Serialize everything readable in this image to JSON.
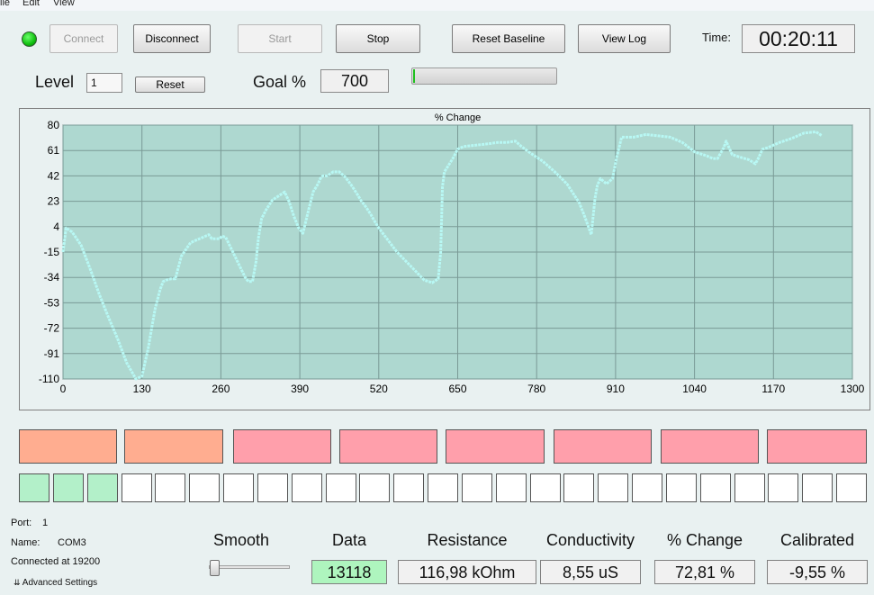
{
  "menu": {
    "file": "ile",
    "edit": "Edit",
    "view": "View"
  },
  "toolbar": {
    "connect": "Connect",
    "disconnect": "Disconnect",
    "start": "Start",
    "stop": "Stop",
    "reset_baseline": "Reset Baseline",
    "view_log": "View Log",
    "time_label": "Time:",
    "time_value": "00:20:11"
  },
  "level": {
    "label": "Level",
    "value": "1",
    "reset": "Reset"
  },
  "goal": {
    "label": "Goal %",
    "value": "700",
    "progress_fraction": 0.01
  },
  "chart_data": {
    "type": "line",
    "title": "% Change",
    "xlabel": "",
    "ylabel": "",
    "xlim": [
      0,
      1300
    ],
    "ylim": [
      -110,
      80
    ],
    "xticks": [
      0,
      130,
      260,
      390,
      520,
      650,
      780,
      910,
      1040,
      1170,
      1300
    ],
    "yticks": [
      80,
      61,
      42,
      23,
      4,
      -15,
      -34,
      -53,
      -72,
      -91,
      -110
    ],
    "grid": true,
    "bg_color": "#aed8d0",
    "line_color": "#b8f8f4",
    "series": [
      {
        "x": [
          0,
          5,
          15,
          30,
          45,
          60,
          75,
          90,
          105,
          120,
          130,
          140,
          148,
          152,
          160,
          165,
          170,
          178,
          185,
          195,
          210,
          230,
          240,
          245,
          258,
          262,
          268,
          285,
          300,
          305,
          312,
          318,
          320,
          322,
          327,
          335,
          345,
          355,
          365,
          372,
          380,
          388,
          395,
          403,
          412,
          420,
          425,
          428,
          435,
          445,
          455,
          465,
          475,
          485,
          490,
          500,
          507,
          512,
          520,
          535,
          550,
          565,
          580,
          595,
          608,
          618,
          622,
          625,
          628,
          635,
          642,
          650,
          660,
          680,
          700,
          715,
          730,
          745,
          755,
          770,
          790,
          810,
          830,
          850,
          858,
          870,
          876,
          880,
          885,
          895,
          905,
          912,
          920,
          940,
          960,
          980,
          1000,
          1020,
          1040,
          1060,
          1070,
          1078,
          1088,
          1092,
          1098,
          1102,
          1115,
          1130,
          1140,
          1145,
          1152,
          1160,
          1180,
          1200,
          1220,
          1240,
          1250
        ],
        "y": [
          -15,
          3,
          0,
          -10,
          -28,
          -47,
          -64,
          -80,
          -98,
          -110,
          -108,
          -88,
          -67,
          -57,
          -43,
          -37,
          -36,
          -35,
          -35,
          -18,
          -8,
          -4,
          -2,
          -5,
          -5,
          -3,
          -4,
          -20,
          -34,
          -37,
          -37,
          -22,
          -12,
          -4,
          10,
          17,
          24,
          27,
          30,
          23,
          12,
          3,
          -1,
          14,
          30,
          36,
          41,
          42,
          42,
          45,
          45,
          41,
          35,
          28,
          24,
          18,
          13,
          9,
          3,
          -6,
          -15,
          -22,
          -29,
          -36,
          -38,
          -35,
          -15,
          34,
          45,
          50,
          55,
          62,
          64,
          65,
          66,
          67,
          67,
          68,
          64,
          59,
          53,
          45,
          36,
          22,
          13,
          -2,
          25,
          35,
          40,
          36,
          40,
          56,
          71,
          71,
          73,
          72,
          71,
          67,
          60,
          57,
          55,
          55,
          63,
          68,
          62,
          58,
          56,
          54,
          51,
          55,
          62,
          63,
          67,
          70,
          74,
          75,
          72
        ]
      }
    ]
  },
  "tiles": [
    {
      "color": "#ffad90"
    },
    {
      "color": "#ffad90"
    },
    {
      "color": "#ff9fab"
    },
    {
      "color": "#ff9fab"
    },
    {
      "color": "#ff9fab"
    },
    {
      "color": "#ff9fab"
    },
    {
      "color": "#ff9fab"
    },
    {
      "color": "#ff9fab"
    }
  ],
  "indicator_count": 25,
  "indicators_lit": 3,
  "info": {
    "port_label": "Port:",
    "port_value": "1",
    "name_label": "Name:",
    "name_value": "COM3",
    "connected": "Connected at 19200",
    "advanced": "Advanced Settings"
  },
  "smooth": {
    "label": "Smooth",
    "value_fraction": 0.0
  },
  "readouts": {
    "data_label": "Data",
    "data_value": "13118",
    "data_color": "#aef5be",
    "resistance_label": "Resistance",
    "resistance_value": "116,98 kOhm",
    "conductivity_label": "Conductivity",
    "conductivity_value": "8,55 uS",
    "change_label": "% Change",
    "change_value": "72,81 %",
    "calibrated_label": "Calibrated",
    "calibrated_value": "-9,55 %"
  }
}
